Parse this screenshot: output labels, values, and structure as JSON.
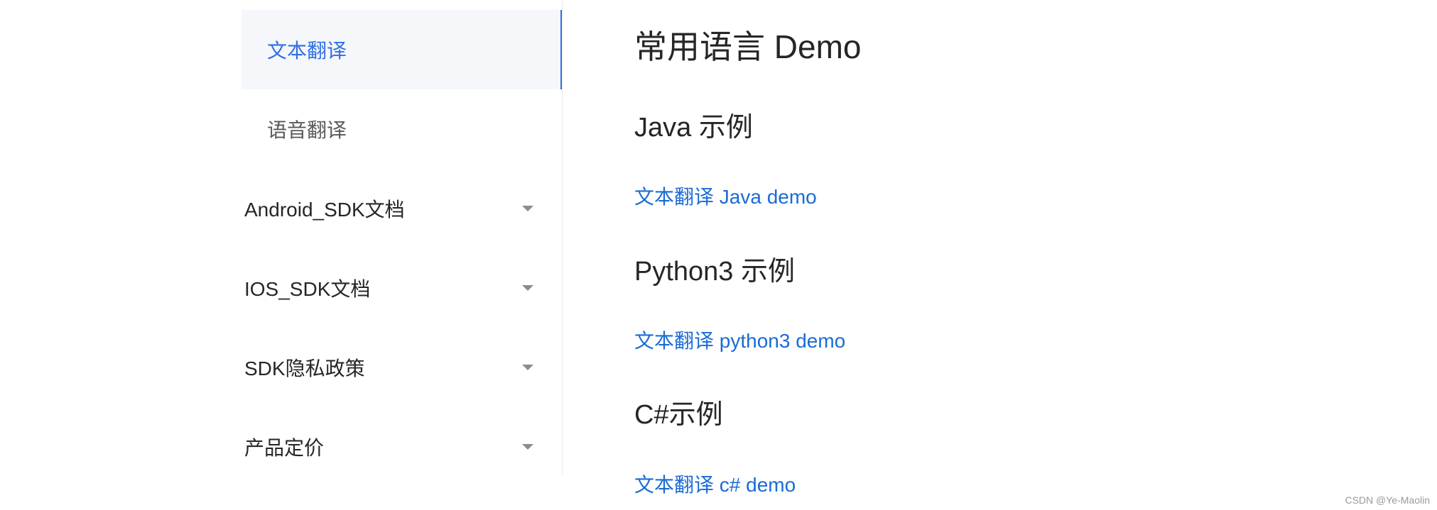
{
  "sidebar": {
    "items": [
      {
        "label": "文本翻译"
      },
      {
        "label": "语音翻译"
      },
      {
        "label": "Android_SDK文档"
      },
      {
        "label": "IOS_SDK文档"
      },
      {
        "label": "SDK隐私政策"
      },
      {
        "label": "产品定价"
      }
    ]
  },
  "main": {
    "title": "常用语言 Demo",
    "sections": [
      {
        "heading": "Java 示例",
        "link": "文本翻译 Java demo"
      },
      {
        "heading": "Python3 示例",
        "link": "文本翻译 python3 demo"
      },
      {
        "heading": "C#示例",
        "link": "文本翻译 c# demo"
      }
    ]
  },
  "watermark": "CSDN @Ye-Maolin",
  "colors": {
    "accent": "#2f6fe4",
    "link": "#1a6bd6",
    "active_bg": "#f5f7fa"
  }
}
